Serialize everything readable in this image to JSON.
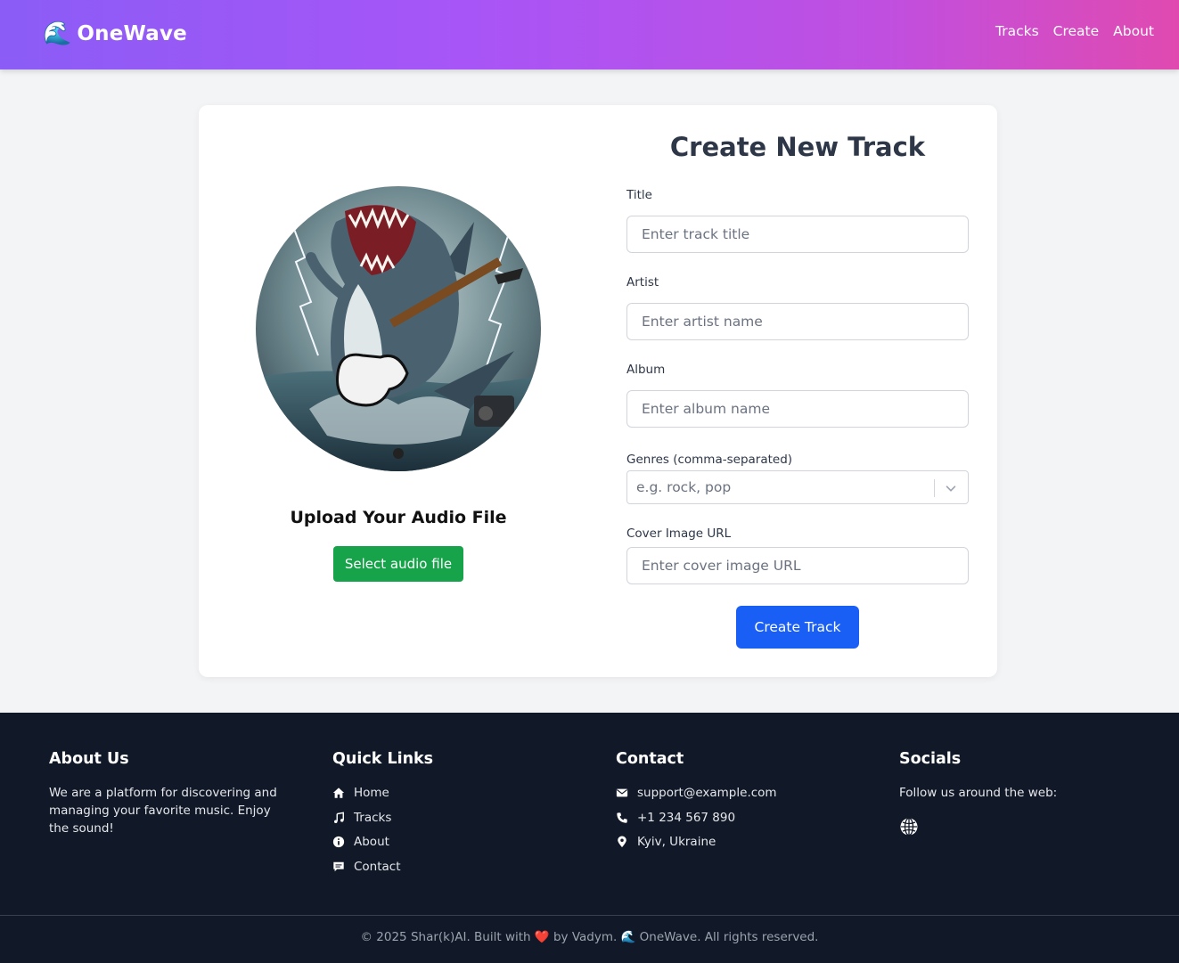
{
  "header": {
    "brand_icon": "🌊",
    "brand_name": "OneWave",
    "nav": [
      "Tracks",
      "Create",
      "About"
    ]
  },
  "upload": {
    "cover_image": "shark-guitar-cover-art",
    "title": "Upload Your Audio File",
    "button_label": "Select audio file"
  },
  "form": {
    "title": "Create New Track",
    "title_label": "Title",
    "title_placeholder": "Enter track title",
    "artist_label": "Artist",
    "artist_placeholder": "Enter artist name",
    "album_label": "Album",
    "album_placeholder": "Enter album name",
    "genres_label": "Genres (comma-separated)",
    "genres_placeholder": "e.g. rock, pop",
    "cover_label": "Cover Image URL",
    "cover_placeholder": "Enter cover image URL",
    "submit_label": "Create Track"
  },
  "footer": {
    "about": {
      "title": "About Us",
      "text": "We are a platform for discovering and managing your favorite music. Enjoy the sound!"
    },
    "links": {
      "title": "Quick Links",
      "items": [
        {
          "icon": "home-icon",
          "label": "Home"
        },
        {
          "icon": "music-icon",
          "label": "Tracks"
        },
        {
          "icon": "info-icon",
          "label": "About"
        },
        {
          "icon": "chat-icon",
          "label": "Contact"
        }
      ]
    },
    "contact": {
      "title": "Contact",
      "items": [
        {
          "icon": "mail-icon",
          "label": "support@example.com"
        },
        {
          "icon": "phone-icon",
          "label": "+1 234 567 890"
        },
        {
          "icon": "location-icon",
          "label": "Kyiv, Ukraine"
        }
      ]
    },
    "socials": {
      "title": "Socials",
      "text": "Follow us around the web:",
      "icon": "globe-icon"
    },
    "copyright": "© 2025 Shar(k)AI. Built with ❤️ by Vadym. 🌊 OneWave. All rights reserved."
  },
  "colors": {
    "header_gradient_start": "#8b5cf6",
    "header_gradient_end": "#e04ab0",
    "upload_button": "#16a34a",
    "submit_button": "#1a5ff5",
    "footer_background": "#111827"
  }
}
